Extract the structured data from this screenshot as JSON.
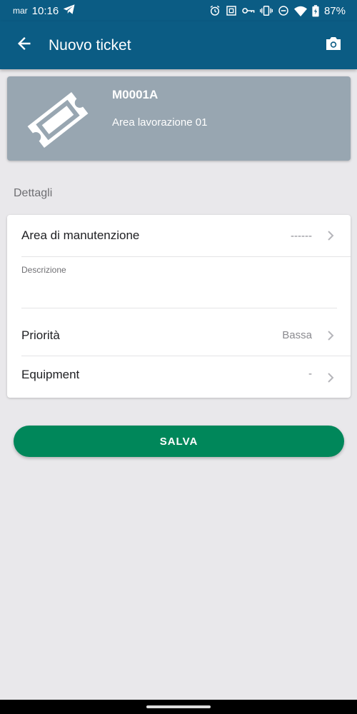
{
  "status_bar": {
    "day": "mar",
    "time": "10:16",
    "battery": "87%",
    "icons": [
      "telegram-icon",
      "alarm-icon",
      "nfc-icon",
      "vpn-key-icon",
      "vibrate-icon",
      "do-not-disturb-icon",
      "wifi-icon",
      "battery-icon"
    ]
  },
  "app_bar": {
    "title": "Nuovo ticket",
    "back_icon": "arrow-back-icon",
    "camera_icon": "camera-icon"
  },
  "header_card": {
    "code": "M0001A",
    "area": "Area lavorazione 01",
    "icon": "ticket-icon",
    "color": "#98a6b1"
  },
  "details": {
    "section_title": "Dettagli",
    "maintenance_area": {
      "label": "Area di manutenzione",
      "value": "------"
    },
    "description": {
      "label": "Descrizione",
      "value": ""
    },
    "priority": {
      "label": "Priorità",
      "value": "Bassa"
    },
    "equipment": {
      "label": "Equipment",
      "value": "-"
    }
  },
  "actions": {
    "save_label": "SALVA",
    "save_color": "#00875a"
  },
  "colors": {
    "primary": "#0b5c84",
    "background": "#e9e8eb"
  }
}
